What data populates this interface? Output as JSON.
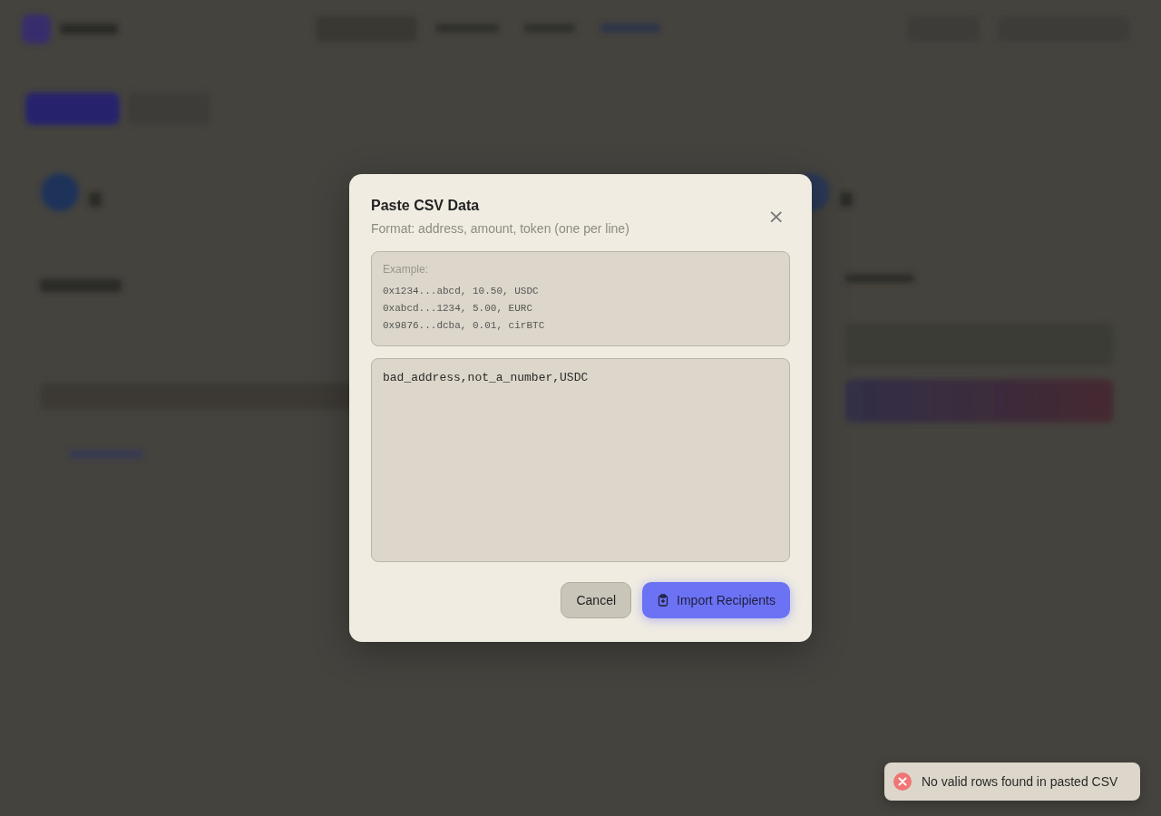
{
  "dialog": {
    "title": "Paste CSV Data",
    "subtitle": "Format: address, amount, token (one per line)",
    "close": "×",
    "example": {
      "label": "Example:",
      "lines": [
        "0x1234...abcd, 10.50, USDC",
        "0xabcd...1234, 5.00, EURC",
        "0x9876...dcba, 0.01, cirBTC"
      ]
    },
    "input": {
      "value": "bad_address,not_a_number,USDC"
    },
    "buttons": [
      {
        "kind": "secondary",
        "label": "Cancel"
      },
      {
        "kind": "primary",
        "label": "Import Recipients"
      }
    ]
  },
  "toast": {
    "kind": "error",
    "message": "No valid rows found in pasted CSV"
  }
}
